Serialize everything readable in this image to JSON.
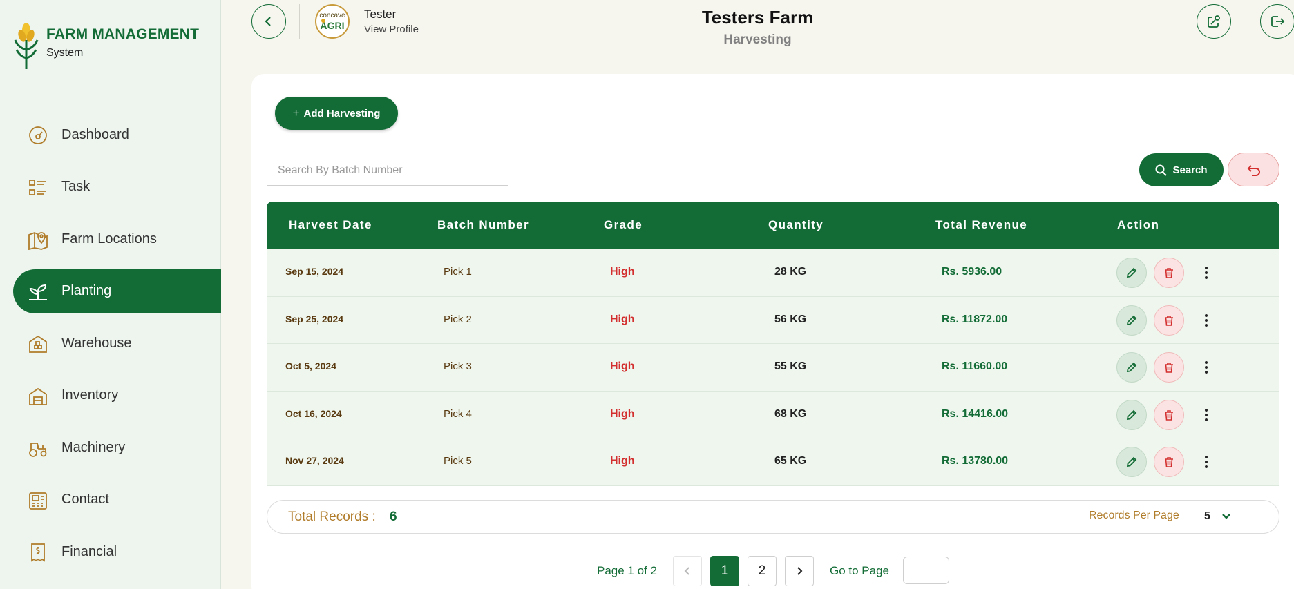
{
  "brand": {
    "title": "FARM MANAGEMENT",
    "subtitle": "System"
  },
  "nav": {
    "items": [
      {
        "label": "Dashboard",
        "icon": "dashboard-gauge-icon"
      },
      {
        "label": "Task",
        "icon": "task-list-icon"
      },
      {
        "label": "Farm Locations",
        "icon": "map-pin-icon"
      },
      {
        "label": "Planting",
        "icon": "plant-sprout-icon",
        "active": true
      },
      {
        "label": "Warehouse",
        "icon": "warehouse-icon"
      },
      {
        "label": "Inventory",
        "icon": "inventory-icon"
      },
      {
        "label": "Machinery",
        "icon": "tractor-icon"
      },
      {
        "label": "Contact",
        "icon": "contact-icon"
      },
      {
        "label": "Financial",
        "icon": "financial-receipt-icon"
      }
    ]
  },
  "header": {
    "user_name": "Tester",
    "view_profile": "View Profile",
    "avatar_text_top": "concave",
    "avatar_text_bottom": "AGRI",
    "farm_title": "Testers Farm",
    "section": "Harvesting"
  },
  "toolbar": {
    "add_label": "Add Harvesting",
    "search_placeholder": "Search By Batch Number",
    "search_value": "",
    "search_label": "Search"
  },
  "table": {
    "headers": [
      "Harvest Date",
      "Batch Number",
      "Grade",
      "Quantity",
      "Total Revenue",
      "Action"
    ],
    "rows": [
      {
        "date": "Sep 15, 2024",
        "batch": "Pick 1",
        "grade": "High",
        "quantity": "28 KG",
        "revenue": "Rs. 5936.00"
      },
      {
        "date": "Sep 25, 2024",
        "batch": "Pick 2",
        "grade": "High",
        "quantity": "56 KG",
        "revenue": "Rs. 11872.00"
      },
      {
        "date": "Oct 5, 2024",
        "batch": "Pick 3",
        "grade": "High",
        "quantity": "55 KG",
        "revenue": "Rs. 11660.00"
      },
      {
        "date": "Oct 16, 2024",
        "batch": "Pick 4",
        "grade": "High",
        "quantity": "68 KG",
        "revenue": "Rs. 14416.00"
      },
      {
        "date": "Nov 27, 2024",
        "batch": "Pick 5",
        "grade": "High",
        "quantity": "65 KG",
        "revenue": "Rs. 13780.00"
      }
    ]
  },
  "footer": {
    "total_label": "Total Records :",
    "total_value": "6",
    "rpp_label": "Records Per Page",
    "rpp_value": "5"
  },
  "pagination": {
    "label": "Page 1 of 2",
    "pages": [
      "1",
      "2"
    ],
    "current": "1",
    "goto_label": "Go to Page"
  },
  "colors": {
    "primary": "#136c36",
    "accent_gold": "#b07c2a",
    "danger": "#d32f2f",
    "sidebar_bg": "#edf5ee",
    "row_bg": "#eef6ee"
  }
}
